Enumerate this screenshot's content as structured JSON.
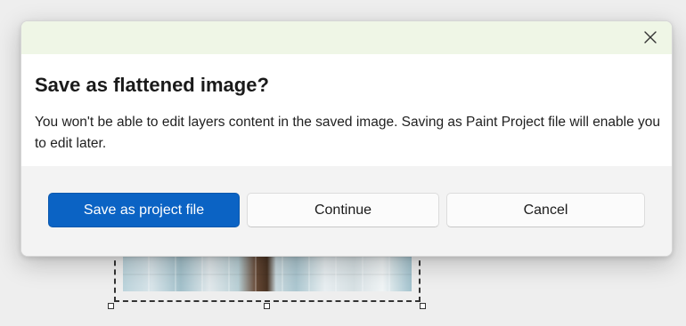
{
  "dialog": {
    "title": "Save as flattened image?",
    "message": "You won't be able to edit layers content in the saved image. Saving as Paint Project file will enable you to edit later.",
    "close_icon": "close-icon",
    "buttons": {
      "save_project": "Save as project file",
      "continue": "Continue",
      "cancel": "Cancel"
    },
    "colors": {
      "header_tint": "#eff6e6",
      "primary": "#0b63c4"
    }
  }
}
